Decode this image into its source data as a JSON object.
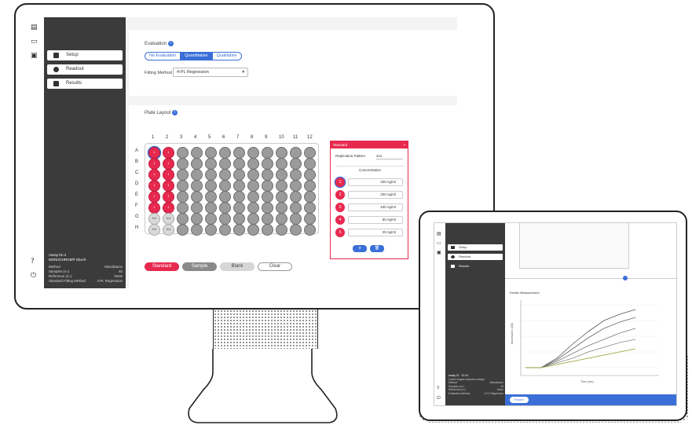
{
  "desktop": {
    "nav": {
      "setup": "Setup",
      "readout": "Readout",
      "results": "Results"
    },
    "assay": {
      "title": "Assay 01-4",
      "subtitle": "MONOCHROM® Glucil+",
      "rows": [
        {
          "k": "Method",
          "v": "Absorbance"
        },
        {
          "k": "Samples (n=)",
          "v": "40"
        },
        {
          "k": "Reference (n=)",
          "v": "None"
        },
        {
          "k": "Standard Fitting Method",
          "v": "4-PL Regression"
        }
      ]
    },
    "evaluation": {
      "label": "Evaluation",
      "info": "i",
      "options": [
        "No Evaluation",
        "Quantitative",
        "Qualitative"
      ],
      "fitting_label": "Fitting Method",
      "fitting_value": "4-PL Regression",
      "dropdown_arrow": "▾"
    },
    "plate": {
      "label": "Plate Layout",
      "info": "i",
      "columns": [
        "1",
        "2",
        "3",
        "4",
        "5",
        "6",
        "7",
        "8",
        "9",
        "10",
        "11",
        "12"
      ],
      "rows": [
        "A",
        "B",
        "C",
        "D",
        "E",
        "F",
        "G",
        "H"
      ],
      "blank_text": "N/A",
      "std_text": "1",
      "buttons": {
        "standard": "Standard",
        "sample": "Sample",
        "blank": "Blank",
        "clear": "Clear"
      }
    },
    "standard_panel": {
      "header": "Standard",
      "close": "×",
      "replication_label": "Replication Pattern",
      "replication_value": "4x1",
      "concentration_label": "Concentration",
      "rows": [
        {
          "idx": "1",
          "value": "400 ng/ml"
        },
        {
          "idx": "2",
          "value": "200 ng/ml"
        },
        {
          "idx": "3",
          "value": "100 ng/ml"
        },
        {
          "idx": "4",
          "value": "50 ng/ml"
        },
        {
          "idx": "5",
          "value": "25 ng/ml"
        }
      ],
      "add": "+",
      "delete": "🗑"
    }
  },
  "tablet": {
    "nav": {
      "setup": "Setup",
      "readout": "Readout",
      "results": "Results"
    },
    "chart_title": "Kinetic Measurement",
    "ylabel": "Absorbance (OD)",
    "xlabel": "Time (min)",
    "assay": {
      "title": "Assay 01 · 12:14",
      "subtitle": "Lorem magna incubatum aliqua",
      "rows": [
        {
          "k": "Method",
          "v": "Absorbance"
        },
        {
          "k": "Samples (n=)",
          "v": "40"
        },
        {
          "k": "Reference (n=)",
          "v": "None"
        },
        {
          "k": "Evaluation Method",
          "v": "4-PL Regression"
        }
      ]
    },
    "export_button": "Export",
    "colors": {
      "accent": "#3a6fd8",
      "standard": "#e8294f",
      "sidebar": "#3b3b3b"
    }
  }
}
